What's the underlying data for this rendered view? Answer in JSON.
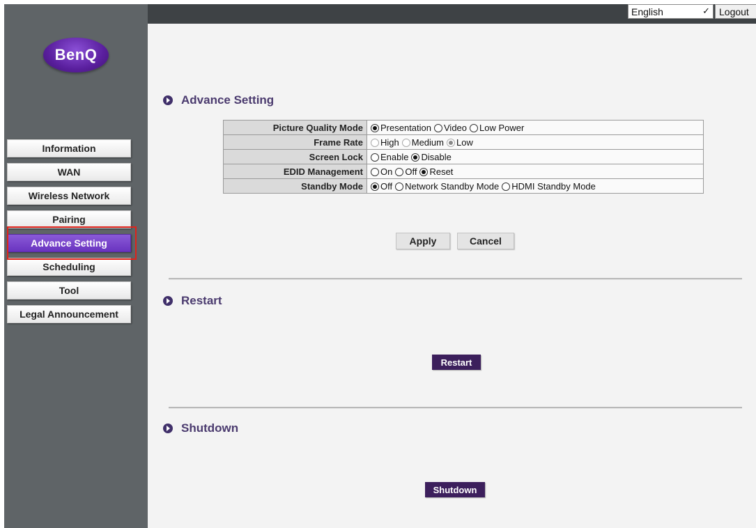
{
  "header": {
    "language": "English",
    "logout_label": "Logout"
  },
  "brand": {
    "logo_text": "BenQ"
  },
  "sidebar": {
    "items": [
      {
        "label": "Information"
      },
      {
        "label": "WAN"
      },
      {
        "label": "Wireless Network"
      },
      {
        "label": "Pairing"
      },
      {
        "label": "Advance Setting",
        "active": true
      },
      {
        "label": "Scheduling"
      },
      {
        "label": "Tool"
      },
      {
        "label": "Legal Announcement"
      }
    ]
  },
  "advance": {
    "title": "Advance Setting",
    "rows": [
      {
        "label": "Picture Quality Mode",
        "options": [
          {
            "text": "Presentation",
            "selected": true
          },
          {
            "text": "Video",
            "selected": false
          },
          {
            "text": "Low Power",
            "selected": false
          }
        ]
      },
      {
        "label": "Frame Rate",
        "disabled": true,
        "options": [
          {
            "text": "High",
            "selected": false
          },
          {
            "text": "Medium",
            "selected": false
          },
          {
            "text": "Low",
            "selected": true
          }
        ]
      },
      {
        "label": "Screen Lock",
        "options": [
          {
            "text": "Enable",
            "selected": false
          },
          {
            "text": "Disable",
            "selected": true
          }
        ]
      },
      {
        "label": "EDID Management",
        "options": [
          {
            "text": "On",
            "selected": false
          },
          {
            "text": "Off",
            "selected": false
          },
          {
            "text": "Reset",
            "selected": true
          }
        ]
      },
      {
        "label": "Standby Mode",
        "options": [
          {
            "text": "Off",
            "selected": true
          },
          {
            "text": "Network Standby Mode",
            "selected": false
          },
          {
            "text": "HDMI Standby Mode",
            "selected": false
          }
        ]
      }
    ],
    "apply_label": "Apply",
    "cancel_label": "Cancel"
  },
  "restart": {
    "title": "Restart",
    "button_label": "Restart"
  },
  "shutdown": {
    "title": "Shutdown",
    "button_label": "Shutdown"
  },
  "colors": {
    "sidebar_bg": "#5f6467",
    "active_nav": "#7a46cc",
    "section_title": "#4a3a6e",
    "action_button": "#3c1f5c",
    "highlight_border": "#e0231b"
  }
}
